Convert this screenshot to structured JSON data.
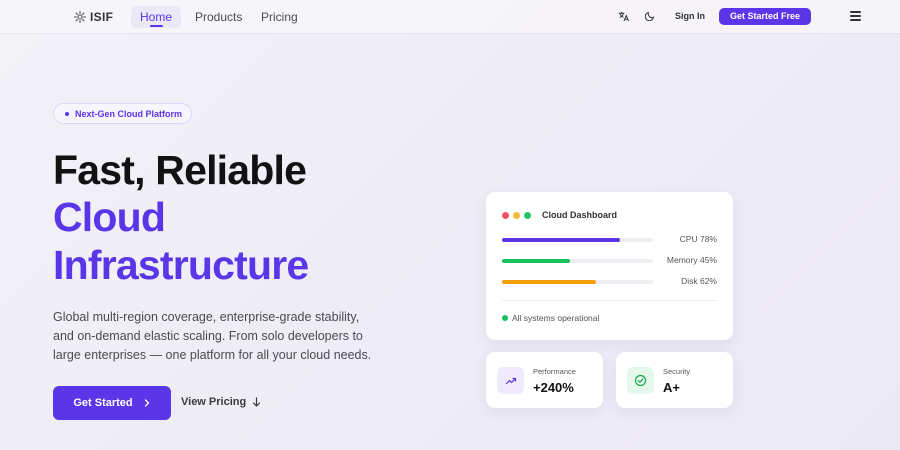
{
  "nav": {
    "logo_text": "ISIF",
    "links": [
      {
        "label": "Home",
        "active": true
      },
      {
        "label": "Products"
      },
      {
        "label": "Pricing"
      }
    ],
    "translate_icon": "translate-icon",
    "theme_icon": "moon-icon",
    "signin_label": "Sign In",
    "cta_label": "Get Started Free",
    "menu_icon": "hamburger-menu-icon"
  },
  "hero": {
    "badge": "Next-Gen Cloud Platform",
    "title_line1": "Fast, Reliable",
    "title_line2": "Cloud",
    "title_line3": "Infrastructure",
    "description": "Global multi-region coverage, enterprise-grade stability, and on-demand elastic scaling. From solo developers to large enterprises — one platform for all your cloud needs.",
    "primary_button": "Get Started",
    "secondary_button": "View Pricing"
  },
  "dashboard": {
    "title": "Cloud Dashboard",
    "window_dots": [
      "#f2545b",
      "#f6b93b",
      "#25c46a"
    ],
    "metrics": [
      {
        "label": "CPU 78%",
        "value": 78,
        "color": "#5b35e8"
      },
      {
        "label": "Memory 45%",
        "value": 45,
        "color": "#16c05b"
      },
      {
        "label": "Disk 62%",
        "value": 62,
        "color": "#f59e0b"
      }
    ],
    "status": "All systems operational"
  },
  "stats": {
    "performance": {
      "label": "Performance",
      "value": "+240%",
      "icon": "trending-up-icon"
    },
    "security": {
      "label": "Security",
      "value": "A+",
      "icon": "check-circle-icon"
    }
  },
  "colors": {
    "accent": "#5b35e8",
    "success": "#16c05b",
    "warning": "#f59e0b",
    "danger": "#f2545b"
  }
}
